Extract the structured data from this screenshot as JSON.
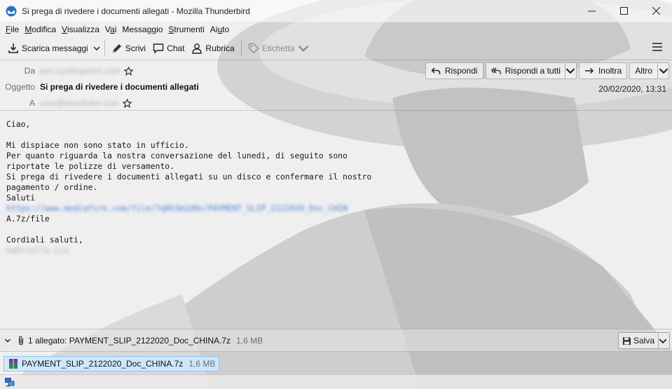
{
  "window": {
    "title": "Si prega di rivedere i documenti allegati - Mozilla Thunderbird"
  },
  "menubar": {
    "items": [
      {
        "label": "File",
        "accel": "F",
        "rest": "ile"
      },
      {
        "label": "Modifica",
        "accel": "M",
        "rest": "odifica"
      },
      {
        "label": "Visualizza",
        "accel": "V",
        "rest": "isualizza"
      },
      {
        "label": "Vai",
        "pre": "V",
        "accel": "a",
        "rest": "i"
      },
      {
        "label": "Messaggio",
        "pre": "Messa",
        "accel": "g",
        "rest": "gio"
      },
      {
        "label": "Strumenti",
        "accel": "S",
        "rest": "trumenti"
      },
      {
        "label": "Aiuto",
        "pre": "Ai",
        "accel": "u",
        "rest": "to"
      }
    ]
  },
  "toolbar": {
    "get_messages": "Scarica messaggi",
    "write": "Scrivi",
    "chat": "Chat",
    "address_book": "Rubrica",
    "tag": "Etichetta"
  },
  "header": {
    "from_label": "Da",
    "from_value": "pec-cyrillicgeshe.com",
    "subject_label": "Oggetto",
    "subject": "Si prega di rivedere i documenti allegati",
    "to_label": "A",
    "to_value": "user@exechoke.com",
    "date": "20/02/2020, 13:31",
    "reply": "Rispondi",
    "reply_all": "Rispondi a tutti",
    "forward": "Inoltra",
    "more": "Altro"
  },
  "message": {
    "lines": [
      {
        "text": "Ciao,",
        "kind": "text"
      },
      {
        "text": "",
        "kind": "text"
      },
      {
        "text": "Mi dispiace non sono stato in ufficio.",
        "kind": "text"
      },
      {
        "text": "Per quanto riguarda la nostra conversazione del lunedì, di seguito sono",
        "kind": "text"
      },
      {
        "text": "riportate le polizze di versamento.",
        "kind": "text"
      },
      {
        "text": "Si prega di rivedere i documenti allegati su un disco e confermare il nostro",
        "kind": "text"
      },
      {
        "text": "pagamento / ordine.",
        "kind": "text"
      },
      {
        "text": "Saluti",
        "kind": "text"
      },
      {
        "text": "https://www.mediafire.com/file/7q8k3m2d9x/PAYMENT_SLIP_2122020_Doc_CHIN",
        "kind": "link"
      },
      {
        "text": "A.7z/file",
        "kind": "text"
      },
      {
        "text": "",
        "kind": "text"
      },
      {
        "text": "Cordiali saluti,",
        "kind": "text"
      },
      {
        "text": "Gabriella Liu",
        "kind": "blur"
      }
    ]
  },
  "attachments": {
    "summary": "1 allegato: PAYMENT_SLIP_2122020_Doc_CHINA.7z",
    "summary_size": "1,6 MB",
    "save": "Salva",
    "items": [
      {
        "name": "PAYMENT_SLIP_2122020_Doc_CHINA.7z",
        "size": "1,6 MB"
      }
    ]
  },
  "colors": {
    "link": "#4a7fd6",
    "selected_attachment": "#cde8ff"
  }
}
